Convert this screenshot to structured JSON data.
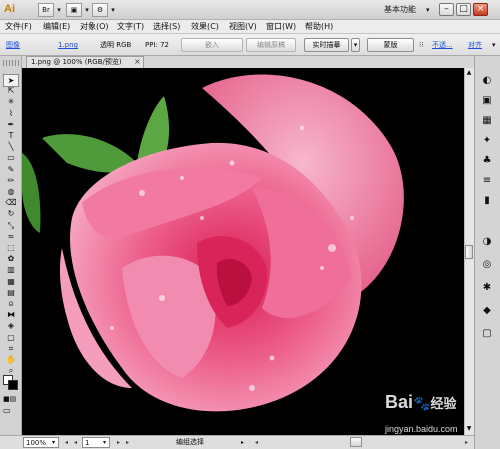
{
  "app": {
    "logo": "Ai",
    "workspace": "基本功能",
    "window_buttons": [
      "–",
      "□",
      "×"
    ]
  },
  "title_toolbar": [
    "Br",
    "▣",
    "⚙"
  ],
  "menu": [
    "文件(F)",
    "编辑(E)",
    "对象(O)",
    "文字(T)",
    "选择(S)",
    "效果(C)",
    "视图(V)",
    "窗口(W)",
    "帮助(H)"
  ],
  "control_bar": {
    "object_type": "图像",
    "file_link": "1.png",
    "color_mode": "透明 RGB",
    "ppi": "PPI: 72",
    "embed_button": "嵌入",
    "edit_original_button": "编辑原稿",
    "live_trace_button": "实时描摹",
    "mask_button": "蒙版",
    "opacity_link": "不透...",
    "align_link": "对齐"
  },
  "document_tab": {
    "title": "1.png @ 100% (RGB/预览)",
    "close": "×"
  },
  "status_bar": {
    "zoom": "100%",
    "artboard": "1",
    "status": "编组选择"
  },
  "watermark": {
    "brand": "Bai🐾经验",
    "brand_main": "Bai",
    "brand_suffix": "经验",
    "url": "jingyan.baidu.com"
  },
  "colors": {
    "canvas_background": "#000000",
    "rose_main": "#e84a7a",
    "rose_light": "#f48fb0",
    "leaf": "#4f9a3a",
    "link": "#1f4fd6"
  },
  "tools": [
    "selection-tool",
    "direct-selection-tool",
    "magic-wand-tool",
    "lasso-tool",
    "pen-tool",
    "type-tool",
    "line-tool",
    "rectangle-tool",
    "paintbrush-tool",
    "pencil-tool",
    "blob-brush-tool",
    "eraser-tool",
    "rotate-tool",
    "scale-tool",
    "warp-tool",
    "free-transform-tool",
    "symbol-sprayer-tool",
    "column-graph-tool",
    "mesh-tool",
    "gradient-tool",
    "eyedropper-tool",
    "blend-tool",
    "live-paint-tool",
    "artboard-tool",
    "slice-tool",
    "hand-tool",
    "zoom-tool"
  ],
  "panels": [
    "color-panel-icon",
    "color-guide-icon",
    "swatches-icon",
    "brushes-icon",
    "symbols-icon",
    "stroke-icon",
    "gradient-icon",
    "transparency-icon",
    "appearance-icon",
    "graphic-styles-icon",
    "layers-icon",
    "artboards-icon"
  ]
}
